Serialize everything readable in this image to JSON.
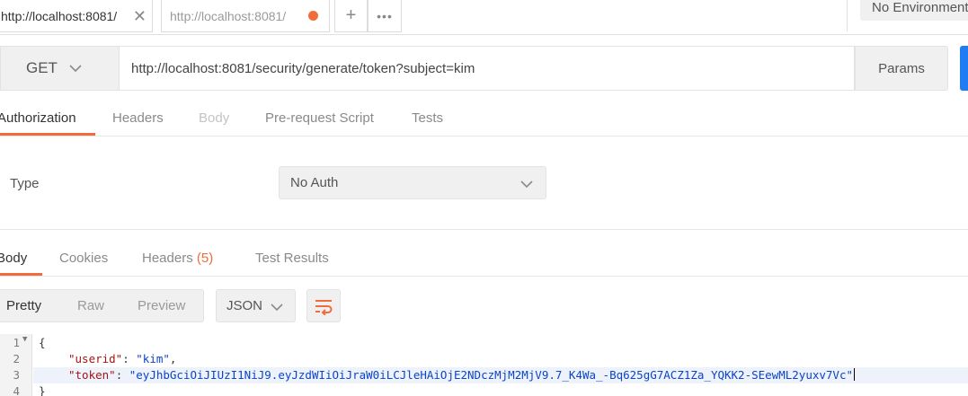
{
  "tabs": [
    {
      "label": "http://localhost:8081/",
      "active": true
    },
    {
      "label": "http://localhost:8081/",
      "unsaved": true
    }
  ],
  "tab_actions": {
    "add": "+",
    "more": "•••"
  },
  "environment": {
    "selected": "No Environment"
  },
  "request": {
    "method": "GET",
    "url": "http://localhost:8081/security/generate/token?subject=kim",
    "params_label": "Params"
  },
  "request_tabs": {
    "authorization": "Authorization",
    "headers": "Headers",
    "body": "Body",
    "prerequest": "Pre-request Script",
    "tests": "Tests"
  },
  "auth": {
    "type_label": "Type",
    "type_value": "No Auth"
  },
  "response_tabs": {
    "body": "Body",
    "cookies": "Cookies",
    "headers": "Headers",
    "headers_count": "(5)",
    "test_results": "Test Results"
  },
  "format": {
    "pretty": "Pretty",
    "raw": "Raw",
    "preview": "Preview",
    "language": "JSON"
  },
  "response_body": {
    "line_numbers": [
      "1",
      "2",
      "3",
      "4"
    ],
    "open_brace": "{",
    "close_brace": "}",
    "userid_key": "\"userid\"",
    "userid_value": "\"kim\"",
    "token_key": "\"token\"",
    "token_value": "\"eyJhbGciOiJIUzI1NiJ9.eyJzdWIiOiJraW0iLCJleHAiOjE2NDczMjM2MjV9.7_K4Wa_-Bq625gG7ACZ1Za_YQKK2-SEewML2yuxv7Vc\""
  },
  "colors": {
    "accent": "#f26b3a",
    "send_button": "#1f7cf2",
    "json_key": "#a31515",
    "json_string": "#0b44c9"
  }
}
